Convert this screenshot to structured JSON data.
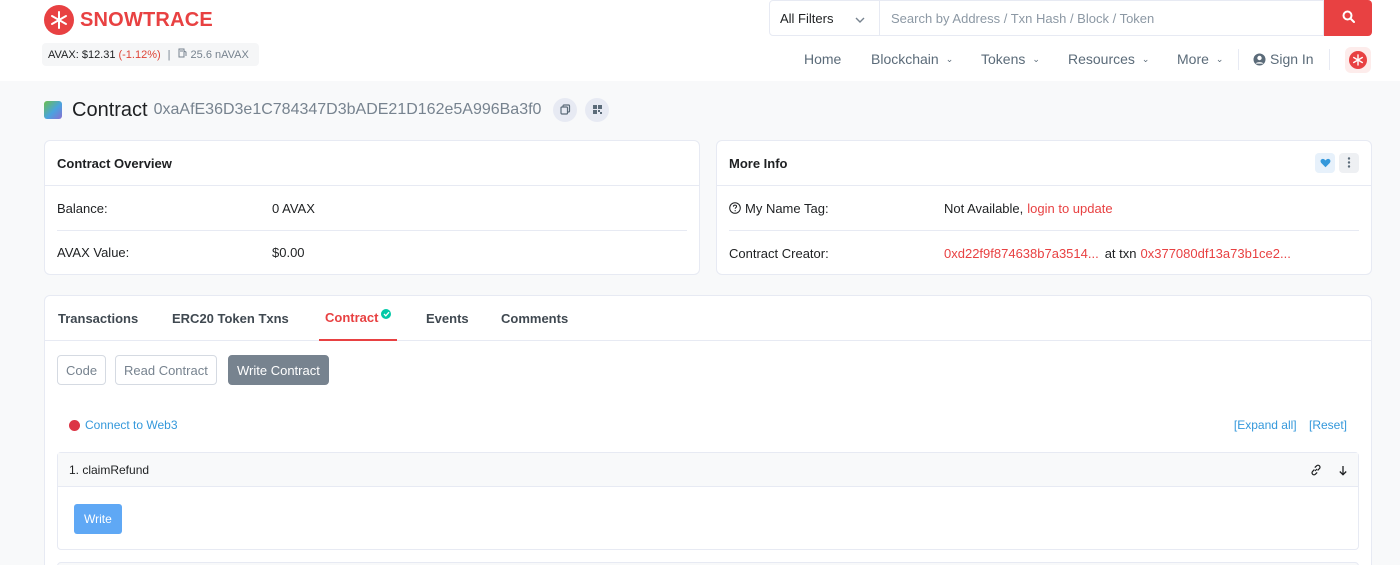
{
  "brand": {
    "name": "SNOWTRACE",
    "color": "#e84142"
  },
  "price": {
    "label": "AVAX: $12.31",
    "change": "(-1.12%)",
    "separator": "|",
    "gas": "25.6 nAVAX"
  },
  "search": {
    "filter": "All Filters",
    "placeholder": "Search by Address / Txn Hash / Block / Token"
  },
  "nav": {
    "home": "Home",
    "blockchain": "Blockchain",
    "tokens": "Tokens",
    "resources": "Resources",
    "more": "More",
    "signin": "Sign In"
  },
  "title": {
    "label": "Contract",
    "hash": "0xaAfE36D3e1C784347D3bADE21D162e5A996Ba3f0"
  },
  "overview": {
    "heading": "Contract Overview",
    "balance_label": "Balance:",
    "balance_value": "0 AVAX",
    "value_label": "AVAX Value:",
    "value_value": "$0.00"
  },
  "more_info": {
    "heading": "More Info",
    "name_tag_label": "My Name Tag:",
    "name_tag_value": "Not Available,",
    "name_tag_link": "login to update",
    "creator_label": "Contract Creator:",
    "creator_address": "0xd22f9f874638b7a3514...",
    "creator_at": "at txn",
    "creator_txn": "0x377080df13a73b1ce2..."
  },
  "tabs": {
    "transactions": "Transactions",
    "erc20": "ERC20 Token Txns",
    "contract": "Contract",
    "events": "Events",
    "comments": "Comments"
  },
  "contract_buttons": {
    "code": "Code",
    "read": "Read Contract",
    "write": "Write Contract"
  },
  "web3": {
    "connect": "Connect to Web3",
    "expand": "[Expand all]",
    "reset": "[Reset]"
  },
  "functions": [
    {
      "label": "1. claimRefund",
      "button": "Write"
    }
  ]
}
